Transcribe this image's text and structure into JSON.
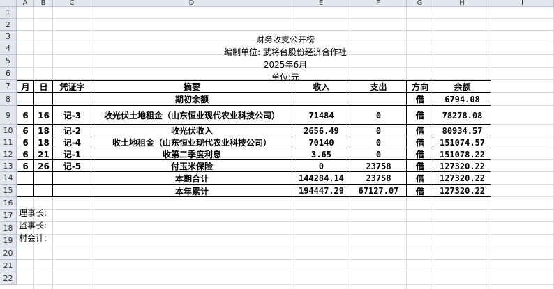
{
  "columns": [
    "A",
    "B",
    "C",
    "D",
    "E",
    "F",
    "G",
    "H",
    "I"
  ],
  "rows": [
    "1",
    "2",
    "3",
    "4",
    "5",
    "6",
    "7",
    "8",
    "9",
    "10",
    "11",
    "12",
    "13",
    "14",
    "15",
    "16",
    "17",
    "18",
    "19",
    "20",
    "21",
    "22"
  ],
  "header_block": {
    "title": "财务收支公开榜",
    "unit_line": "编制单位: 武将台股份经济合作社",
    "date": "2025年6月",
    "currency": "单位:元"
  },
  "table_headers": [
    "月",
    "日",
    "凭证字",
    "摘要",
    "收入",
    "支出",
    "方向",
    "余额"
  ],
  "table_rows": [
    {
      "month": "",
      "day": "",
      "voucher": "",
      "summary": "期初余额",
      "income": "",
      "expense": "",
      "direction": "借",
      "balance": "6794.08"
    },
    {
      "month": "6",
      "day": "16",
      "voucher": "记-3",
      "summary": "收光伏土地租金（山东恒业现代农业科技公司）",
      "income": "71484",
      "expense": "0",
      "direction": "借",
      "balance": "78278.08"
    },
    {
      "month": "6",
      "day": "18",
      "voucher": "记-2",
      "summary": "收光伏收入",
      "income": "2656.49",
      "expense": "0",
      "direction": "借",
      "balance": "80934.57"
    },
    {
      "month": "6",
      "day": "18",
      "voucher": "记-4",
      "summary": "收土地租金（山东恒业现代农业科技公司）",
      "income": "70140",
      "expense": "0",
      "direction": "借",
      "balance": "151074.57"
    },
    {
      "month": "6",
      "day": "21",
      "voucher": "记-1",
      "summary": "收第二季度利息",
      "income": "3.65",
      "expense": "0",
      "direction": "借",
      "balance": "151078.22"
    },
    {
      "month": "6",
      "day": "26",
      "voucher": "记-5",
      "summary": "付玉米保险",
      "income": "0",
      "expense": "23758",
      "direction": "借",
      "balance": "127320.22"
    },
    {
      "month": "",
      "day": "",
      "voucher": "",
      "summary": "本期合计",
      "income": "144284.14",
      "expense": "23758",
      "direction": "借",
      "balance": "127320.22"
    },
    {
      "month": "",
      "day": "",
      "voucher": "",
      "summary": "本年累计",
      "income": "194447.29",
      "expense": "67127.07",
      "direction": "借",
      "balance": "127320.22"
    }
  ],
  "footer": {
    "chairman": "理事长:",
    "supervisor": "监事长:",
    "accountant": "村会计:"
  }
}
